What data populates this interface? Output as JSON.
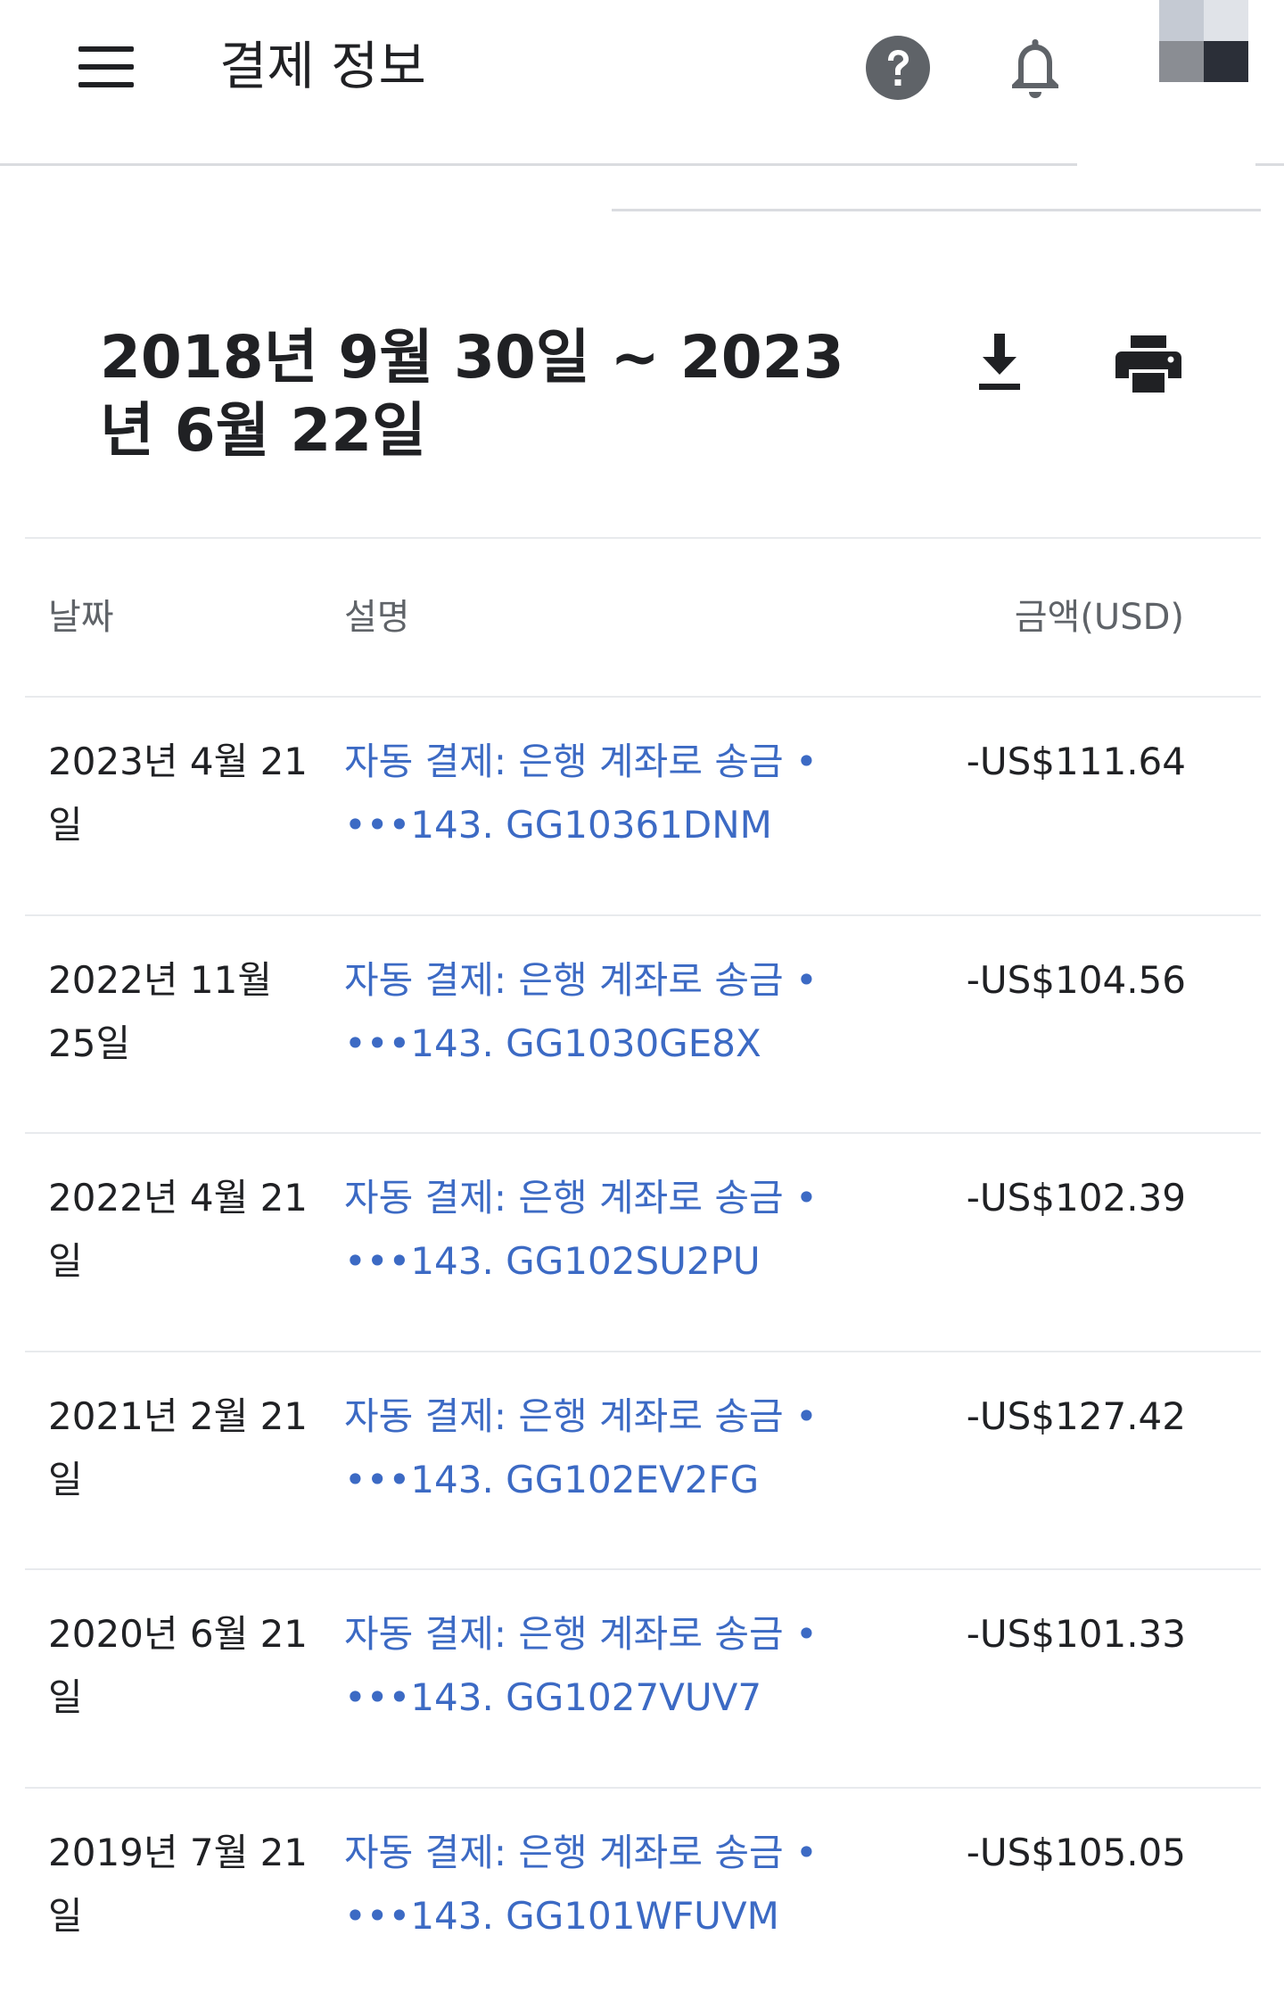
{
  "appbar": {
    "title": "결제 정보",
    "menu_icon": "menu-icon",
    "help_icon": "help-icon",
    "bell_icon": "bell-icon",
    "avatar_colors": [
      "#c5cad3",
      "#e0e3e8",
      "#8a8d93",
      "#2b2f38"
    ]
  },
  "statement": {
    "period": "2018년 9월 30일 ~ 2023년 6월 22일",
    "download_icon": "download-icon",
    "print_icon": "print-icon"
  },
  "table": {
    "headers": {
      "date": "날짜",
      "description": "설명",
      "amount": "금액(USD)"
    },
    "rows": [
      {
        "date": "2023년 4월 21일",
        "description": "자동 결제: 은행 계좌로 송금 • •••143. GG10361DNM",
        "amount": "-US$111.64"
      },
      {
        "date": "2022년 11월 25일",
        "description": "자동 결제: 은행 계좌로 송금 • •••143. GG1030GE8X",
        "amount": "-US$104.56"
      },
      {
        "date": "2022년 4월 21일",
        "description": "자동 결제: 은행 계좌로 송금 • •••143. GG102SU2PU",
        "amount": "-US$102.39"
      },
      {
        "date": "2021년 2월 21일",
        "description": "자동 결제: 은행 계좌로 송금 • •••143. GG102EV2FG",
        "amount": "-US$127.42"
      },
      {
        "date": "2020년 6월 21일",
        "description": "자동 결제: 은행 계좌로 송금 • •••143. GG1027VUV7",
        "amount": "-US$101.33"
      },
      {
        "date": "2019년 7월 21일",
        "description": "자동 결제: 은행 계좌로 송금 • •••143. GG101WFUVM",
        "amount": "-US$105.05"
      }
    ]
  },
  "colors": {
    "link": "#3c6ac4",
    "text": "#202124",
    "muted": "#5f6368",
    "divider": "#dadce0"
  }
}
